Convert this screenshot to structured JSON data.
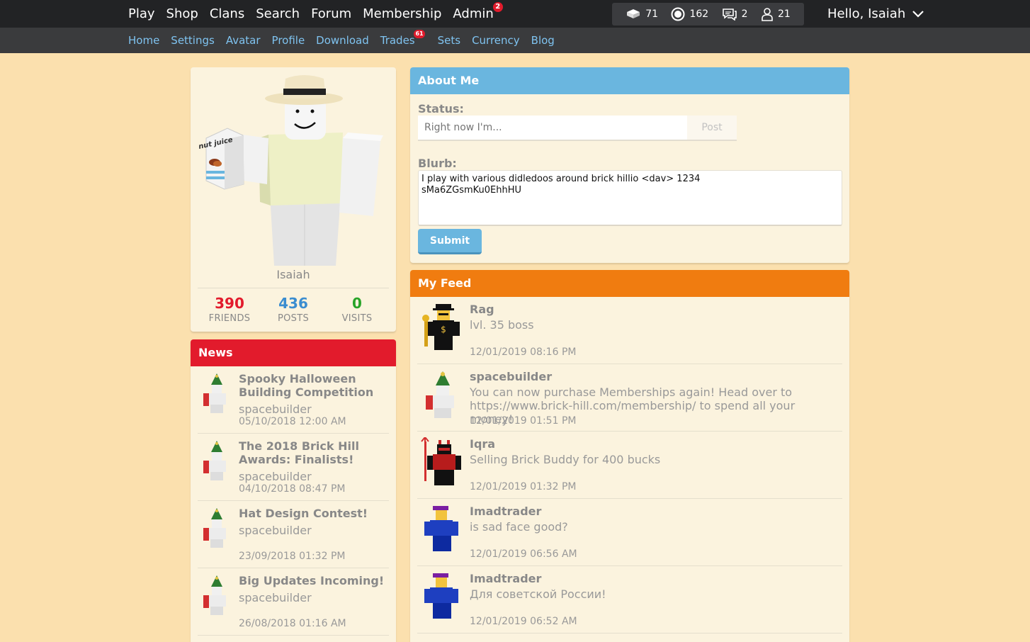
{
  "topnav": {
    "items": [
      {
        "label": "Play"
      },
      {
        "label": "Shop"
      },
      {
        "label": "Clans"
      },
      {
        "label": "Search"
      },
      {
        "label": "Forum"
      },
      {
        "label": "Membership"
      },
      {
        "label": "Admin",
        "badge": "2"
      }
    ],
    "stats": {
      "bricks": "71",
      "bits": "162",
      "messages": "2",
      "friend_requests": "21"
    },
    "greeting": "Hello, Isaiah"
  },
  "subnav": {
    "items": [
      {
        "label": "Home"
      },
      {
        "label": "Settings"
      },
      {
        "label": "Avatar"
      },
      {
        "label": "Profile"
      },
      {
        "label": "Download"
      },
      {
        "label": "Trades",
        "badge": "61"
      },
      {
        "label": "Sets"
      },
      {
        "label": "Currency"
      },
      {
        "label": "Blog"
      }
    ]
  },
  "profile": {
    "avatar_prop_text": "nut juice",
    "username": "Isaiah",
    "friends": {
      "value": "390",
      "label": "FRIENDS",
      "color": "#e21b2c"
    },
    "posts": {
      "value": "436",
      "label": "POSTS",
      "color": "#3b8dd0"
    },
    "visits": {
      "value": "0",
      "label": "VISITS",
      "color": "#28a428"
    }
  },
  "news": {
    "title": "News",
    "items": [
      {
        "title": "Spooky Halloween Building Competition",
        "author": "spacebuilder",
        "date": "05/10/2018 12:00 AM"
      },
      {
        "title": "The 2018 Brick Hill Awards: Finalists!",
        "author": "spacebuilder",
        "date": "04/10/2018 08:47 PM"
      },
      {
        "title": "Hat Design Contest!",
        "author": "spacebuilder",
        "date": "23/09/2018 01:32 PM"
      },
      {
        "title": "Big Updates Incoming!",
        "author": "spacebuilder",
        "date": "26/08/2018 01:16 AM"
      }
    ]
  },
  "about": {
    "title": "About Me",
    "status_label": "Status:",
    "status_placeholder": "Right now I'm...",
    "post_label": "Post",
    "blurb_label": "Blurb:",
    "blurb_value": "I play with various didledoos around brick hillio <dav> 1234\nsMa6ZGsmKu0EhhHU",
    "submit_label": "Submit"
  },
  "feed": {
    "title": "My Feed",
    "items": [
      {
        "name": "Rag",
        "message": "lvl. 35 boss",
        "date": "12/01/2019 08:16 PM",
        "avatar": "rag"
      },
      {
        "name": "spacebuilder",
        "message": "You can now purchase Memberships again! Head over to https://www.brick-hill.com/membership/ to spend all your money!",
        "date": "12/01/2019 01:51 PM",
        "avatar": "spacebuilder"
      },
      {
        "name": "Iqra",
        "message": "Selling Brick Buddy for 400 bucks",
        "date": "12/01/2019 01:32 PM",
        "avatar": "devil"
      },
      {
        "name": "Imadtrader",
        "message": "is sad face good?",
        "date": "12/01/2019 06:56 AM",
        "avatar": "trader"
      },
      {
        "name": "Imadtrader",
        "message": "Для советской России!",
        "date": "12/01/2019 06:52 AM",
        "avatar": "trader"
      }
    ]
  }
}
